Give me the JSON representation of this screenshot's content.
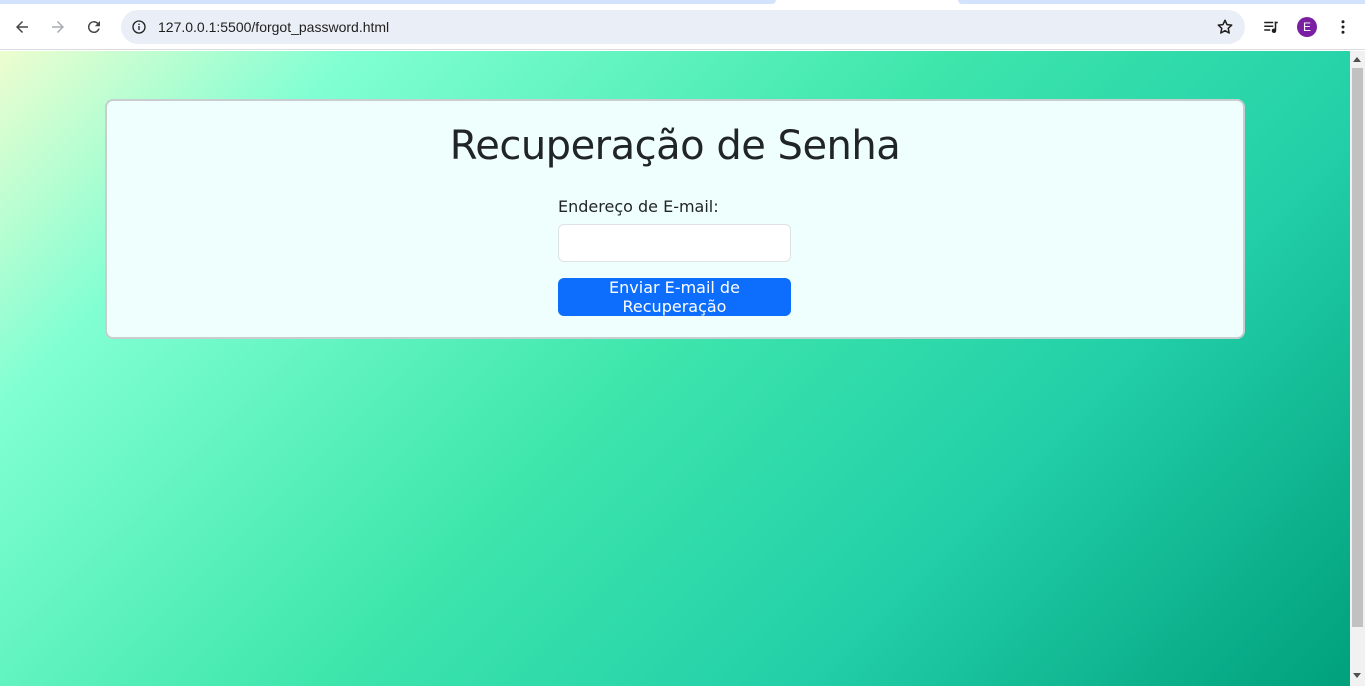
{
  "browser": {
    "url": "127.0.0.1:5500/forgot_password.html",
    "profile_initial": "E",
    "icons": {
      "back": "arrow-left-icon",
      "forward": "arrow-right-icon",
      "reload": "reload-icon",
      "site_info": "info-icon",
      "bookmark": "star-icon",
      "media": "media-queue-icon",
      "menu": "kebab-menu-icon"
    }
  },
  "page": {
    "title": "Recuperação de Senha",
    "email_label": "Endereço de E-mail:",
    "email_value": "",
    "submit_label": "Enviar E-mail de Recuperação"
  },
  "colors": {
    "button_bg": "#0d6efd",
    "card_bg": "#effffd",
    "avatar_bg": "#7b1fa2"
  }
}
